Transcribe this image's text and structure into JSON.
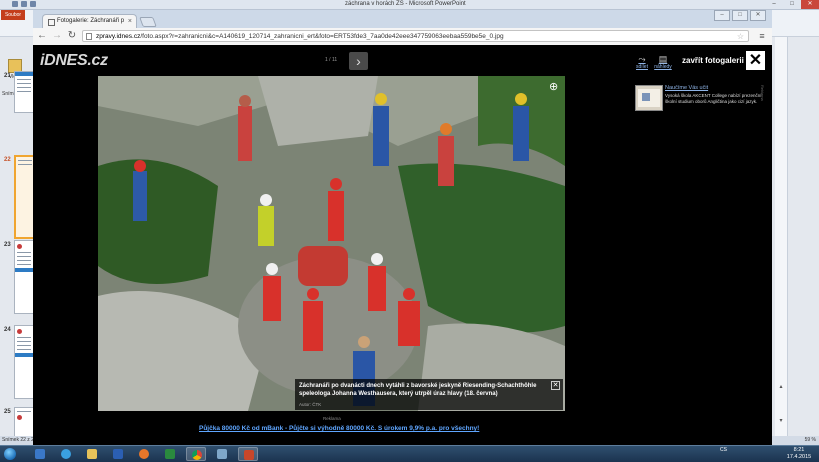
{
  "powerpoint": {
    "title": "záchrana v horách ZS - Microsoft PowerPoint",
    "file_tab": "Soubor",
    "paste_label": "Vložit",
    "slides_header": "Snímky",
    "slide_numbers": [
      "21",
      "22",
      "23",
      "24",
      "25"
    ],
    "selected_slide": "22",
    "status": "Snímek 22 z 25",
    "zoom": "59 %"
  },
  "chrome": {
    "tab_title": "Fotogalerie: Záchranáři p",
    "tab_close": "×",
    "url_host": "zpravy.idnes.cz",
    "url_path": "/foto.aspx?r=zahranicni&c=A140619_120714_zahranicni_ert&foto=ERT53fde3_7aa0de42eee347759063eebaa559be5e_0.jpg"
  },
  "gallery": {
    "logo": "iDNES.cz",
    "counter": "1 / 11",
    "share_label": "sdílet",
    "thumbs_label": "náhledy",
    "close_label": "zavřít fotogalerii",
    "caption": "Záchranáři po dvanácti dnech vytáhli z bavorské jeskyně Riesending-Schachthöhle speleologa Johanna Westhausera, který utrpěl úraz hlavy (18. června)",
    "caption_author": "Autor: ČTK",
    "side_ad_title": "Naučíme Vás učit",
    "side_ad_text": "Vysoká škola AKCENT College nabízí prezenční školní studium oborů Angličtina jako cizí jazyk.",
    "side_ad_vertical": "Reklama",
    "ad_label": "Reklama",
    "ad_link": "Půjčka 80000 Kč od mBank - Půjčte si výhodně 80000 Kč. S úrokem 9,9% p.a. pro všechny!"
  },
  "taskbar": {
    "tray_lang": "CS",
    "time": "8:21",
    "date": "17.4.2015"
  },
  "colors": {
    "ppt_accent": "#c43e1c",
    "link_blue": "#5fa6ff",
    "gallery_bg": "#000000"
  }
}
